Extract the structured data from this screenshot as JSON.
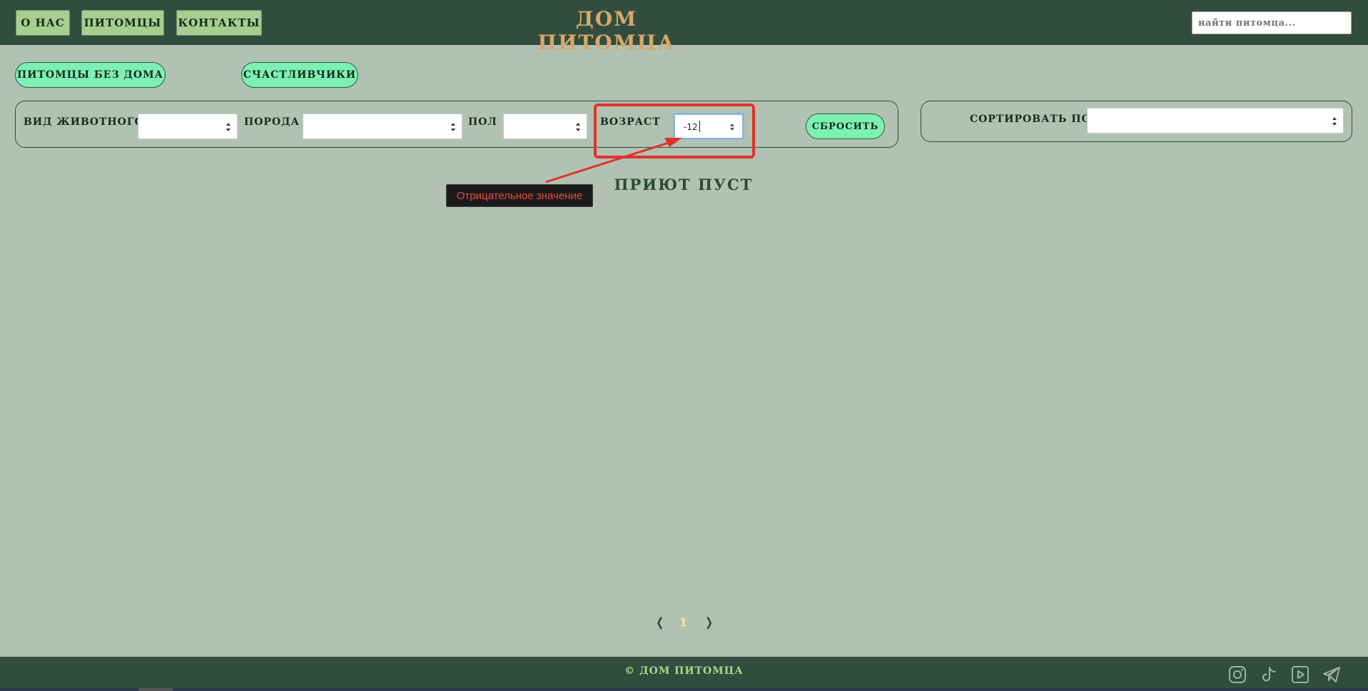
{
  "nav": {
    "about": "о нас",
    "pets": "питомцы",
    "contacts": "контакты"
  },
  "site_title": "дом питомца",
  "search": {
    "placeholder": "найти питомца..."
  },
  "tabs": {
    "homeless": "питомцы без дома",
    "lucky": "счастливчики"
  },
  "filters": {
    "species_label": "вид животного",
    "breed_label": "порода",
    "gender_label": "пол",
    "age_label": "возраст",
    "age_value": "-12",
    "reset_label": "сбросить"
  },
  "sort": {
    "label": "сортировать по"
  },
  "validation": {
    "tooltip": "Отрицательное значение"
  },
  "content": {
    "empty_message": "приют пуст"
  },
  "pagination": {
    "prev": "❬",
    "page": "1",
    "next": "❭"
  },
  "footer": {
    "copyright": "© дом питомца"
  },
  "colors": {
    "header_bg": "#324d3e",
    "page_bg": "#b1c2b2",
    "accent_green": "#7df0b4",
    "nav_button": "#a6cf8f",
    "title_gold": "#d7a86a",
    "highlight_red": "#e0322d",
    "page_number": "#ecec9a"
  },
  "icons": [
    "instagram-icon",
    "tiktok-icon",
    "youtube-icon",
    "telegram-icon"
  ]
}
